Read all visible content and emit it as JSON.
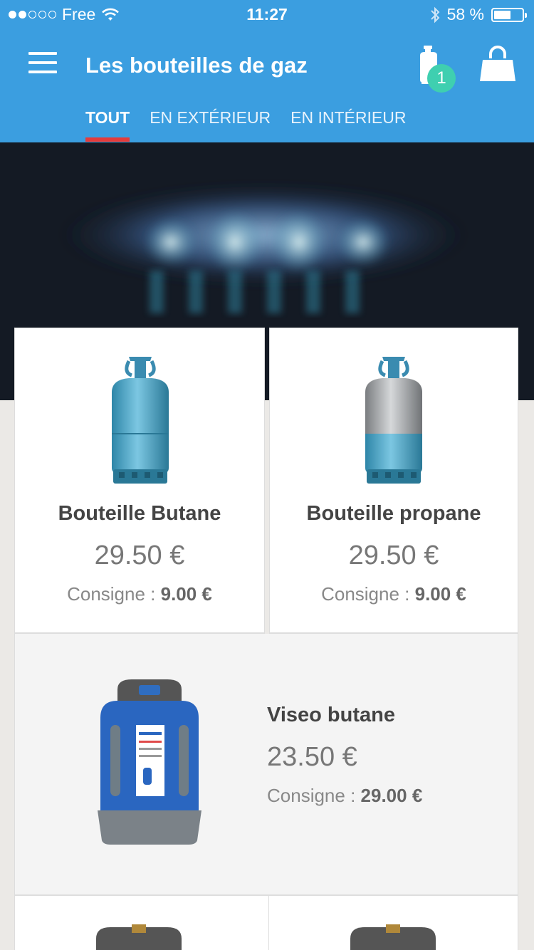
{
  "status_bar": {
    "carrier": "Free",
    "time": "11:27",
    "battery": "58 %"
  },
  "header": {
    "title": "Les bouteilles de gaz",
    "cart_count": "1"
  },
  "tabs": [
    {
      "label": "TOUT"
    },
    {
      "label": "EN EXTÉRIEUR"
    },
    {
      "label": "EN INTÉRIEUR"
    }
  ],
  "products": [
    {
      "name": "Bouteille Butane",
      "price": "29.50 €",
      "deposit_label": "Consigne : ",
      "deposit_value": "9.00 €"
    },
    {
      "name": "Bouteille propane",
      "price": "29.50 €",
      "deposit_label": "Consigne : ",
      "deposit_value": "9.00 €"
    },
    {
      "name": "Viseo butane",
      "price": "23.50 €",
      "deposit_label": "Consigne : ",
      "deposit_value": "29.00 €"
    }
  ],
  "colors": {
    "header": "#3b9ee0",
    "active_tab_indicator": "#e53b3b",
    "badge": "#3fcfb0"
  }
}
